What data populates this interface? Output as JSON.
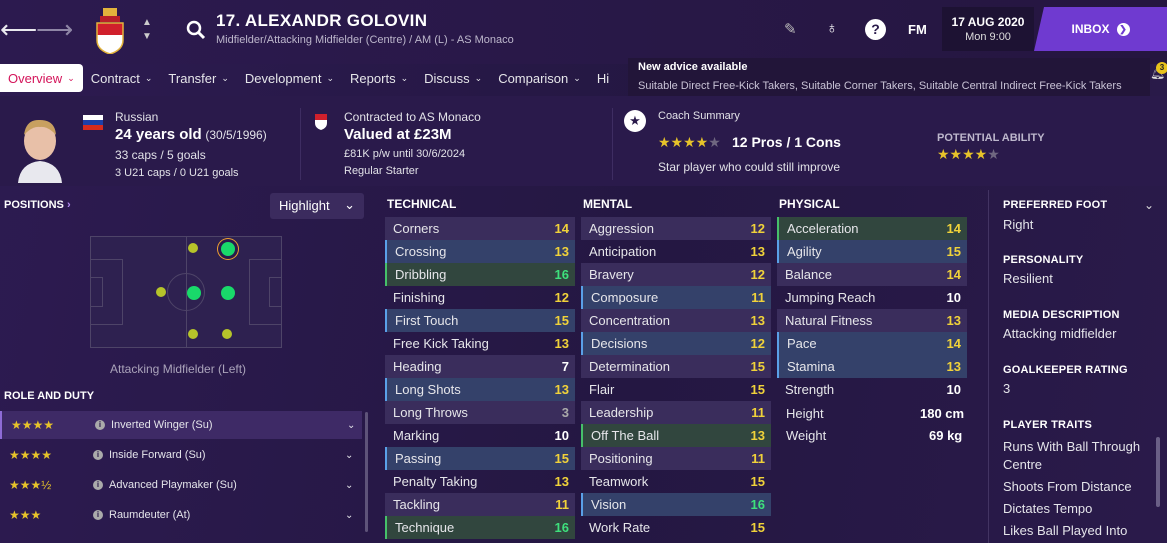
{
  "header": {
    "back_icon": "arrow-left-icon",
    "forward_icon": "arrow-right-icon",
    "player_name": "17. ALEXANDR GOLOVIN",
    "subtitle": "Midfielder/Attacking Midfielder (Centre) / AM (L) - AS Monaco",
    "fm": "FM",
    "date": "17 AUG 2020",
    "time": "Mon 9:00",
    "inbox": "INBOX"
  },
  "tabs": [
    {
      "label": "Overview",
      "chev": "⌄"
    },
    {
      "label": "Contract",
      "chev": "⌄"
    },
    {
      "label": "Transfer",
      "chev": "⌄"
    },
    {
      "label": "Development",
      "chev": "⌄"
    },
    {
      "label": "Reports",
      "chev": "⌄"
    },
    {
      "label": "Discuss",
      "chev": "⌄"
    },
    {
      "label": "Comparison",
      "chev": "⌄"
    },
    {
      "label": "Hi",
      "chev": ""
    }
  ],
  "advice": {
    "title": "New advice available",
    "text": "Suitable Direct Free-Kick Takers, Suitable Corner Takers, Suitable Central Indirect Free-Kick Takers",
    "badge": "3"
  },
  "profile": {
    "nationality": "Russian",
    "age": "24 years old",
    "dob": "(30/5/1996)",
    "caps": "33 caps / 5 goals",
    "u21": "3 U21 caps / 0 U21 goals"
  },
  "contract": {
    "club": "Contracted to AS Monaco",
    "value": "Valued at £23M",
    "wage": "£81K p/w until 30/6/2024",
    "status": "Regular Starter"
  },
  "coach": {
    "title": "Coach Summary",
    "pros": "12 Pros / 1 Cons",
    "note": "Star player who could still improve",
    "current_stars": 4,
    "potential_label": "POTENTIAL ABILITY",
    "potential_stars": 4
  },
  "positions": {
    "title": "POSITIONS",
    "chev": "›",
    "highlight": "Highlight",
    "highlight_chev": "⌄",
    "label": "Attacking Midfielder (Left)"
  },
  "roles": {
    "title": "ROLE AND DUTY",
    "items": [
      {
        "stars": "★★★★",
        "name": "Inverted Winger (Su)",
        "chev": "⌄"
      },
      {
        "stars": "★★★★",
        "name": "Inside Forward (Su)",
        "chev": "⌄"
      },
      {
        "stars": "★★★½",
        "name": "Advanced Playmaker (Su)",
        "chev": "⌄"
      },
      {
        "stars": "★★★",
        "name": "Raumdeuter (At)",
        "chev": "⌄"
      }
    ]
  },
  "technical": {
    "title": "TECHNICAL",
    "rows": [
      [
        "Corners",
        "14"
      ],
      [
        "Crossing",
        "13"
      ],
      [
        "Dribbling",
        "16"
      ],
      [
        "Finishing",
        "12"
      ],
      [
        "First Touch",
        "15"
      ],
      [
        "Free Kick Taking",
        "13"
      ],
      [
        "Heading",
        "7"
      ],
      [
        "Long Shots",
        "13"
      ],
      [
        "Long Throws",
        "3"
      ],
      [
        "Marking",
        "10"
      ],
      [
        "Passing",
        "15"
      ],
      [
        "Penalty Taking",
        "13"
      ],
      [
        "Tackling",
        "11"
      ],
      [
        "Technique",
        "16"
      ]
    ]
  },
  "mental": {
    "title": "MENTAL",
    "rows": [
      [
        "Aggression",
        "12"
      ],
      [
        "Anticipation",
        "13"
      ],
      [
        "Bravery",
        "12"
      ],
      [
        "Composure",
        "11"
      ],
      [
        "Concentration",
        "13"
      ],
      [
        "Decisions",
        "12"
      ],
      [
        "Determination",
        "15"
      ],
      [
        "Flair",
        "15"
      ],
      [
        "Leadership",
        "11"
      ],
      [
        "Off The Ball",
        "13"
      ],
      [
        "Positioning",
        "11"
      ],
      [
        "Teamwork",
        "15"
      ],
      [
        "Vision",
        "16"
      ],
      [
        "Work Rate",
        "15"
      ]
    ]
  },
  "physical": {
    "title": "PHYSICAL",
    "rows": [
      [
        "Acceleration",
        "14"
      ],
      [
        "Agility",
        "15"
      ],
      [
        "Balance",
        "14"
      ],
      [
        "Jumping Reach",
        "10"
      ],
      [
        "Natural Fitness",
        "13"
      ],
      [
        "Pace",
        "14"
      ],
      [
        "Stamina",
        "13"
      ],
      [
        "Strength",
        "10"
      ]
    ],
    "height_label": "Height",
    "height": "180 cm",
    "weight_label": "Weight",
    "weight": "69 kg"
  },
  "side": {
    "foot_label": "PREFERRED FOOT",
    "foot": "Right",
    "chev": "⌄",
    "personality_label": "PERSONALITY",
    "personality": "Resilient",
    "media_label": "MEDIA DESCRIPTION",
    "media": "Attacking midfielder",
    "gk_label": "GOALKEEPER RATING",
    "gk": "3",
    "traits_label": "PLAYER TRAITS",
    "traits": [
      "Runs With Ball Through Centre",
      "Shoots From Distance",
      "Dictates Tempo",
      "Likes Ball Played Into"
    ]
  }
}
